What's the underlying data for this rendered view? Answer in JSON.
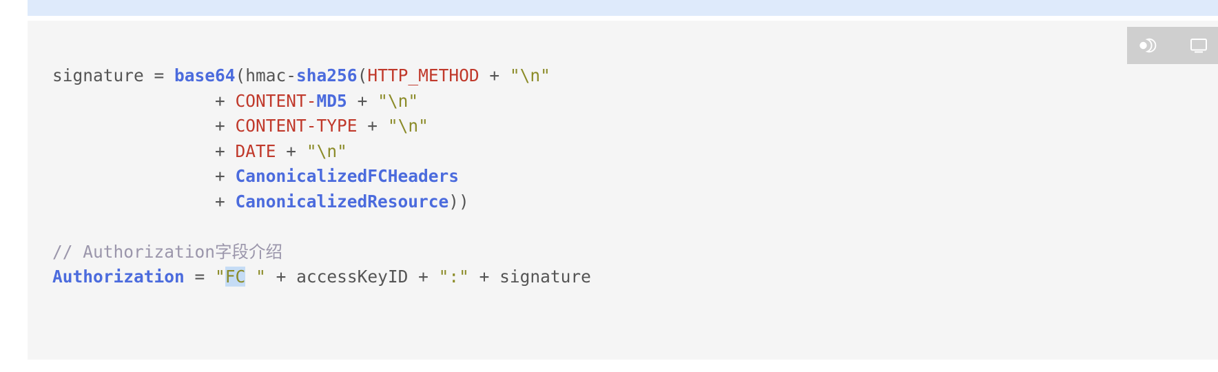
{
  "page": {
    "background": "#ffffff",
    "highlight_strip_color": "#deeafb",
    "code_block_background": "#f5f5f5"
  },
  "toolbar": {
    "background": "#cfcfcf",
    "icons": [
      {
        "name": "theme-toggle-icon",
        "label": "theme-toggle"
      },
      {
        "name": "display-mode-icon",
        "label": "display-mode"
      }
    ]
  },
  "code": {
    "language_colors": {
      "plain": "#555555",
      "keyword": "#4b6bdd",
      "constant": "#c0392b",
      "string": "#8b8b28",
      "comment": "#9b96ab",
      "selection": "#c5dcf5"
    },
    "line1": {
      "a": "signature = ",
      "b": "base64",
      "c": "(hmac-",
      "d": "sha256",
      "e": "(",
      "f": "HTTP_METHOD",
      "g": " + ",
      "h": "\"\\n\""
    },
    "line2": {
      "indent": "                ",
      "plus": "+ ",
      "a": "CONTENT-",
      "b": "MD5",
      "c": " + ",
      "d": "\"\\n\""
    },
    "line3": {
      "indent": "                ",
      "plus": "+ ",
      "a": "CONTENT-TYPE",
      "b": " + ",
      "c": "\"\\n\""
    },
    "line4": {
      "indent": "                ",
      "plus": "+ ",
      "a": "DATE",
      "b": " + ",
      "c": "\"\\n\""
    },
    "line5": {
      "indent": "                ",
      "plus": "+ ",
      "a": "CanonicalizedFCHeaders"
    },
    "line6": {
      "indent": "                ",
      "plus": "+ ",
      "a": "CanonicalizedResource",
      "b": "))"
    },
    "line7": {
      "comment": "// Authorization字段介绍"
    },
    "line8": {
      "a": "Authorization",
      "b": " = ",
      "q1": "\"",
      "sel": "FC",
      "q1b": " \"",
      "c": " + accessKeyID + ",
      "d": "\":\"",
      "e": " + signature"
    }
  }
}
